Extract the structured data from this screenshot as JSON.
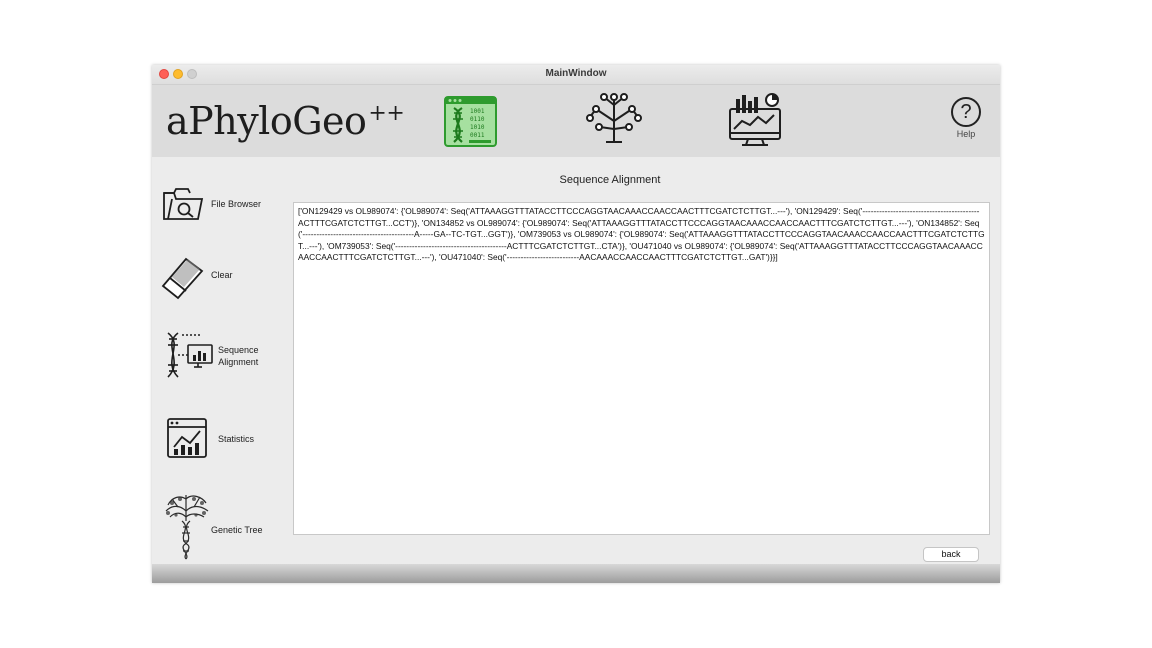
{
  "window": {
    "title": "MainWindow"
  },
  "header": {
    "logo_text": "aPhyloGeo",
    "logo_suffix": "++",
    "icons": [
      "dna-alignment-icon",
      "tree-icon",
      "statistics-monitor-icon"
    ],
    "help_label": "Help",
    "help_symbol": "?"
  },
  "sidebar": {
    "items": [
      {
        "label": "File Browser",
        "icon": "folder-search-icon"
      },
      {
        "label": "Clear",
        "icon": "eraser-icon"
      },
      {
        "label": "Sequence\nAlignment",
        "icon": "dna-chart-icon"
      },
      {
        "label": "Statistics",
        "icon": "stats-chart-icon"
      },
      {
        "label": "Genetic Tree",
        "icon": "tree-dna-icon"
      }
    ]
  },
  "main": {
    "section_title": "Sequence Alignment",
    "output_text": "['ON129429 vs OL989074': {'OL989074': Seq('ATTAAAGGTTTATACCTTCCCAGGTAACAAACCAACCAACTTTCGATCTCTTGT...---'), 'ON129429': Seq('------------------------------------------ACTTTCGATCTCTTGT...CCT')}, 'ON134852 vs OL989074': {'OL989074': Seq('ATTAAAGGTTTATACCTTCCCAGGTAACAAACCAACCAACTTTCGATCTCTTGT...---'), 'ON134852': Seq('----------------------------------------A-----GA--TC-TGT...GGT')}, 'OM739053 vs OL989074': {'OL989074': Seq('ATTAAAGGTTTATACCTTCCCAGGTAACAAACCAACCAACTTTCGATCTCTTGT...---'), 'OM739053': Seq('----------------------------------------ACTTTCGATCTCTTGT...CTA')}, 'OU471040 vs OL989074': {'OL989074': Seq('ATTAAAGGTTTATACCTTCCCAGGTAACAAACCAACCAACTTTCGATCTCTTGT...---'), 'OU471040': Seq('--------------------------AACAAACCAACCAACTTTCGATCTCTTGT...GAT')}}]",
    "back_label": "back"
  },
  "colors": {
    "accent_green": "#2e9b2e",
    "highlight_green": "#a6e0a0"
  }
}
